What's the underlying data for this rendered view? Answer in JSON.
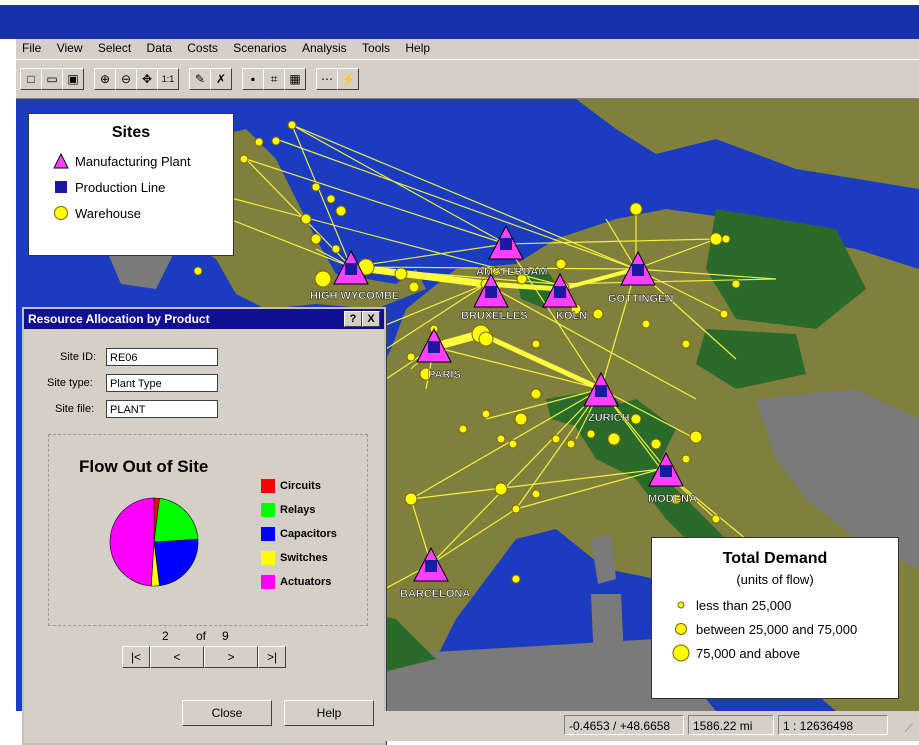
{
  "menu": [
    "File",
    "View",
    "Select",
    "Data",
    "Costs",
    "Scenarios",
    "Analysis",
    "Tools",
    "Help"
  ],
  "toolbar_icons": [
    "new-icon",
    "open-icon",
    "save-icon",
    "zoom-in-icon",
    "zoom-out-icon",
    "pan-icon",
    "actual-size-icon",
    "select-icon",
    "erase-icon",
    "add-site-icon",
    "find-icon",
    "optimize-icon",
    "flow-icon",
    "run-icon"
  ],
  "toolbar_glyphs": [
    "□",
    "▭",
    "▣",
    "⊕",
    "⊖",
    "✥",
    "1:1",
    "✎",
    "✗",
    "▪",
    "⌗",
    "▦",
    "⋯",
    "⚡"
  ],
  "sites_legend": {
    "title": "Sites",
    "items": [
      "Manufacturing Plant",
      "Production Line",
      "Warehouse"
    ]
  },
  "cities": [
    "HIGH WYCOMBE",
    "AMSTERDAM",
    "BRUXELLES",
    "KOLN",
    "GOTTINGEN",
    "PARIS",
    "ZURICH",
    "MODENA",
    "BARCELONA"
  ],
  "dialog": {
    "title": "Resource Allocation by Product",
    "help_btn": "?",
    "close_btn": "X",
    "site_id_label": "Site ID:",
    "site_id": "RE06",
    "site_type_label": "Site type:",
    "site_type": "Plant Type",
    "site_file_label": "Site file:",
    "site_file": "PLANT",
    "chart_title": "Flow Out of Site",
    "page_current": "2",
    "page_of": "of",
    "page_total": "9",
    "nav": [
      "|<",
      "<",
      ">",
      ">|"
    ],
    "close_label": "Close",
    "help_label": "Help"
  },
  "chart_data": {
    "type": "pie",
    "title": "Flow Out of Site",
    "categories": [
      "Circuits",
      "Relays",
      "Capacitors",
      "Switches",
      "Actuators"
    ],
    "values": [
      2,
      22,
      24,
      3,
      49
    ],
    "colors": [
      "#ff0000",
      "#00ff00",
      "#0000ff",
      "#ffff00",
      "#ff00ff"
    ]
  },
  "demand_legend": {
    "title": "Total Demand",
    "subtitle": "(units of flow)",
    "items": [
      "less than 25,000",
      "between 25,000 and 75,000",
      "75,000 and above"
    ]
  },
  "status": {
    "coords": "-0.4653 / +48.6658",
    "distance": "1586.22 mi",
    "scale": "1 : 12636498"
  },
  "colors": {
    "sea": "#1b3cc0",
    "land": "#80803c",
    "land_dark": "#2a6a2a",
    "other_land": "#7a7a7a",
    "flow": "#ffff40",
    "plant": "#ff40ff",
    "line": "#1a1aa0",
    "warehouse": "#ffff00"
  }
}
